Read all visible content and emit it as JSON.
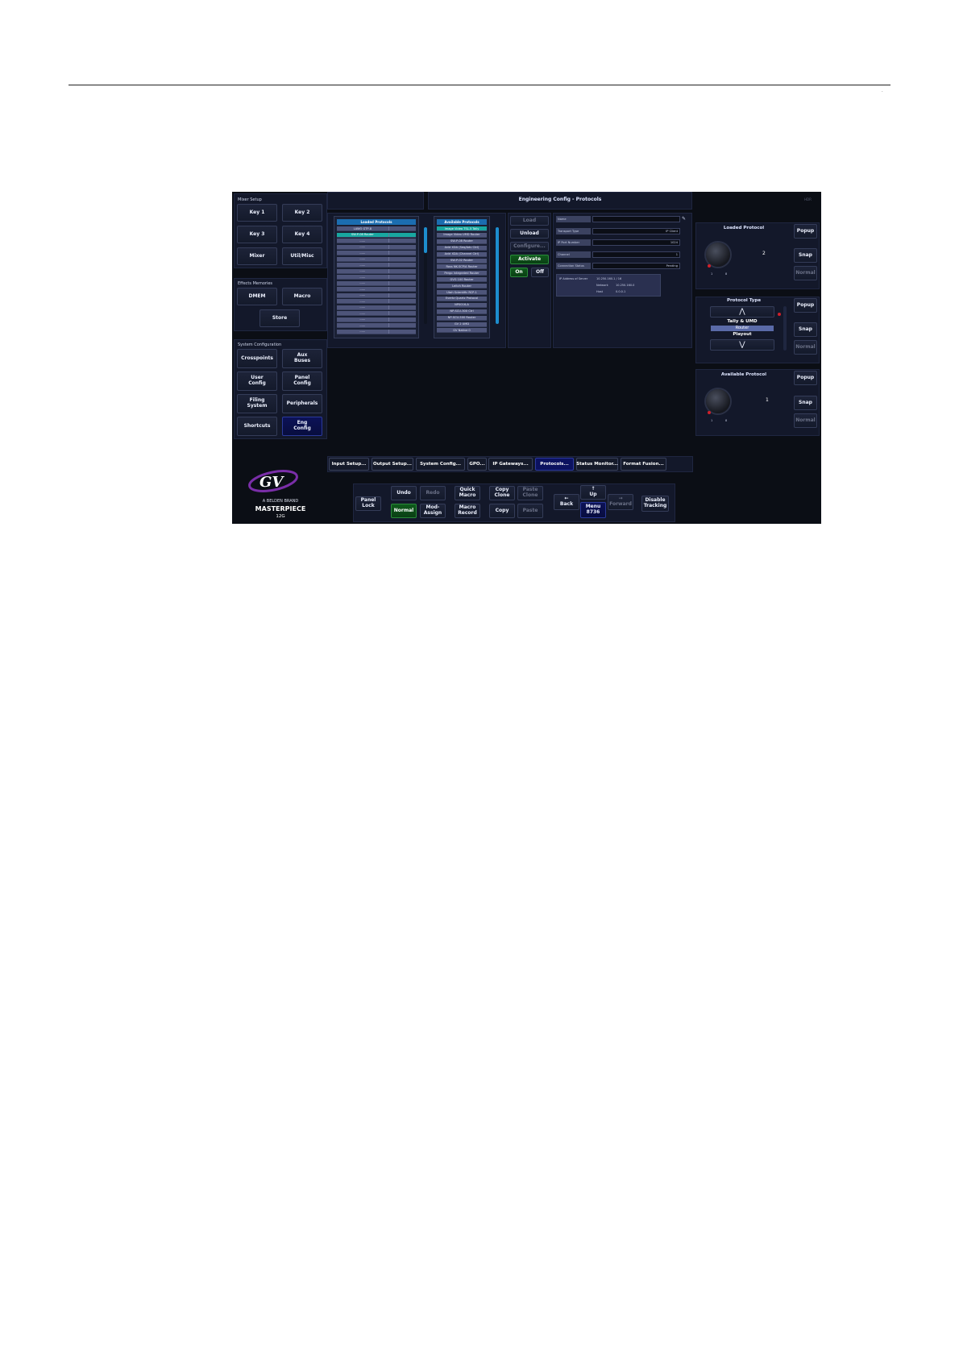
{
  "page_number": ".",
  "header": {
    "title": "Engineering Config - Protocols",
    "hidden_label": "HDR"
  },
  "mixer_setup": {
    "title": "Mixer Setup",
    "buttons": [
      "Key 1",
      "Key 2",
      "Key 3",
      "Key 4",
      "Mixer",
      "Util/Misc"
    ]
  },
  "effects_memories": {
    "title": "Effects Memories",
    "dmem": "DMEM",
    "macro": "Macro",
    "store": "Store"
  },
  "system_configuration": {
    "title": "System Configuration",
    "buttons": [
      "Crosspoints",
      "Aux\nBuses",
      "User\nConfig",
      "Panel\nConfig",
      "Filing\nSystem",
      "Peripherals",
      "Shortcuts",
      "Eng\nConfig"
    ]
  },
  "logo": {
    "brand": "A BELDEN BRAND",
    "product": "MASTERPIECE",
    "model": "12G",
    "mark": "GV"
  },
  "loaded_protocols": {
    "title": "Loaded Protocols",
    "items": [
      "LAWO GTP-8",
      "SW-P-08 Router"
    ],
    "empty_rows": 16,
    "placeholder": "......"
  },
  "available_protocols": {
    "title": "Available Protocols",
    "items": [
      "Image Video TSL-5 Tally",
      "Image Video UMD Router",
      "SW-P-08 Router",
      "Avid XDA (Seq/Adv Ctrl)",
      "Avid XDA (Channel Ctrl)",
      "SW-P-02 Router",
      "Ross NK-SCP/A Router",
      "Pergo Integrated Router",
      "GVG 100 Router",
      "Leitch Router",
      "Utah Scientific RCP-1",
      "Evertz Quartz Protocol",
      "NP0016-A",
      "NP-SCU-300 Ctrl",
      "NP-SCU-500 Router",
      "GV 2 UMD",
      "GV Native 0"
    ]
  },
  "actions": {
    "load": "Load",
    "unload": "Unload",
    "configure": "Configure...",
    "activate": "Activate",
    "on": "On",
    "off": "Off"
  },
  "fields": [
    {
      "label": "Name",
      "value": ""
    },
    {
      "label": "Transport Type",
      "value": "IP Client"
    },
    {
      "label": "IP Port Number",
      "value": "1024"
    },
    {
      "label": "Channel",
      "value": "1"
    },
    {
      "label": "Connection Status",
      "value": "Pending"
    }
  ],
  "ip_info": {
    "address_label": "IP Address of Server",
    "address_value": "10.250.160.1 / 16",
    "network_label": "Network",
    "network_value": "10.250.160.0",
    "host_label": "Host",
    "host_value": "0.0.0.1"
  },
  "loaded_protocol_ctrl": {
    "title": "Loaded Protocol",
    "value": "2",
    "knob_min": "1",
    "knob_max": "8",
    "popup": "Popup",
    "snap": "Snap",
    "normal": "Normal"
  },
  "protocol_type": {
    "title": "Protocol Type",
    "up": "⋀",
    "down": "⋁",
    "options": [
      "Tally & UMD",
      "Router",
      "Playout"
    ],
    "selected_index": 1,
    "popup": "Popup",
    "snap": "Snap",
    "normal": "Normal"
  },
  "available_protocol_ctrl": {
    "title": "Available Protocol",
    "value": "1",
    "knob_min": "1",
    "knob_max": "8",
    "popup": "Popup",
    "snap": "Snap",
    "normal": "Normal"
  },
  "tabs": [
    "Input Setup...",
    "Output Setup...",
    "System Config...",
    "GPO...",
    "IP Gateways...",
    "Protocols...",
    "Status Monitor...",
    "Format Fusion..."
  ],
  "active_tab": "Protocols...",
  "toolbar": {
    "panel_lock": "Panel\nLock",
    "undo": "Undo",
    "redo": "Redo",
    "normal": "Normal",
    "mod_assign": "Mod-\nAssign",
    "quick_macro": "Quick\nMacro",
    "macro_record": "Macro\nRecord",
    "copy_clone": "Copy\nClone",
    "paste_clone": "Paste\nClone",
    "copy": "Copy",
    "paste": "Paste",
    "back": "←\nBack",
    "up": "↑\nUp",
    "menu": "Menu\n8736",
    "forward": "→\nForward",
    "disable_tracking": "Disable\nTracking"
  }
}
